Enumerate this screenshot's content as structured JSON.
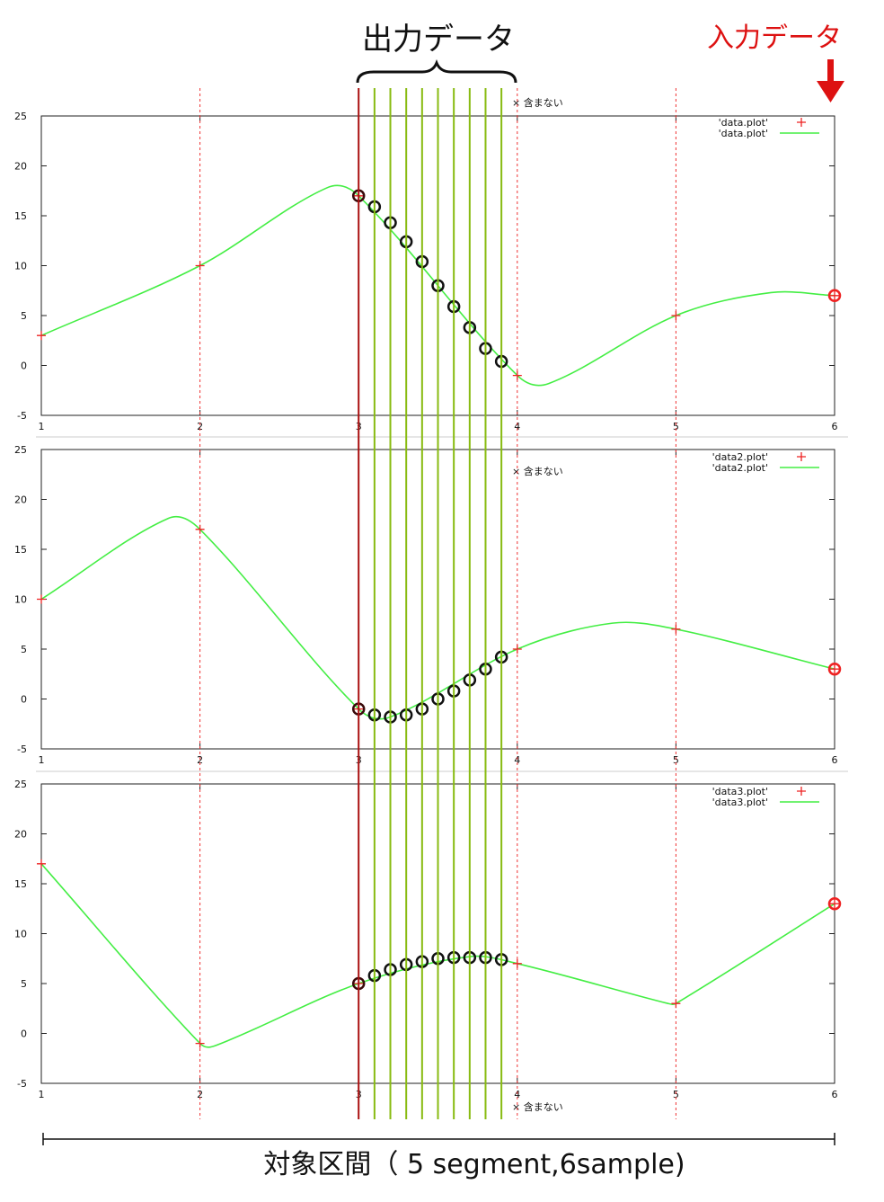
{
  "header": {
    "output_label": "出力データ",
    "input_label": "入力データ",
    "input_color": "#dd1111"
  },
  "footer": {
    "range_label": "対象区間（ 5 segment,6sample)"
  },
  "colors": {
    "curve": "#44ee44",
    "sample_marker": "#ee2222",
    "grid_dash": "#ee3333",
    "segment_start_line": "#aa1111",
    "output_line": "#88bb11",
    "output_circle": "#111111"
  },
  "icons": [
    "brace-icon",
    "down-arrow-icon",
    "cross-mark-icon"
  ],
  "chart_data": [
    {
      "type": "line",
      "xlim": [
        1,
        6
      ],
      "ylim": [
        -5,
        25
      ],
      "x_ticks": [
        "1",
        "2",
        "3",
        "4",
        "5",
        "6"
      ],
      "y_ticks": [
        "25",
        "20",
        "15",
        "10",
        "5",
        "0",
        "-5"
      ],
      "grid": false,
      "legend_position": "top-right",
      "legend": [
        "'data.plot'",
        "'data.plot'"
      ],
      "note": "× 含まない",
      "samples": {
        "x": [
          1,
          2,
          3,
          4,
          5,
          6
        ],
        "y": [
          3,
          10,
          17,
          -1,
          5,
          7
        ]
      },
      "curve_peaks": [
        {
          "x": 2.8,
          "y": 17.8
        },
        {
          "x": 4.2,
          "y": -1.8
        },
        {
          "x": 5.6,
          "y": 7.3
        }
      ],
      "output": {
        "x": [
          3.0,
          3.1,
          3.2,
          3.3,
          3.4,
          3.5,
          3.6,
          3.7,
          3.8,
          3.9
        ],
        "y": [
          17.0,
          15.9,
          14.3,
          12.4,
          10.4,
          8.0,
          5.9,
          3.8,
          1.7,
          0.4
        ]
      },
      "input_highlight": {
        "x": 6,
        "y": 7
      }
    },
    {
      "type": "line",
      "xlim": [
        1,
        6
      ],
      "ylim": [
        -5,
        25
      ],
      "x_ticks": [
        "1",
        "2",
        "3",
        "4",
        "5",
        "6"
      ],
      "y_ticks": [
        "25",
        "20",
        "15",
        "10",
        "5",
        "0",
        "-5"
      ],
      "grid": false,
      "legend_position": "top-right",
      "legend": [
        "'data2.plot'",
        "'data2.plot'"
      ],
      "note": "× 含まない",
      "samples": {
        "x": [
          1,
          2,
          3,
          4,
          5,
          6
        ],
        "y": [
          10,
          17,
          -1,
          5,
          7,
          3
        ]
      },
      "curve_peaks": [
        {
          "x": 1.8,
          "y": 18.1
        },
        {
          "x": 3.2,
          "y": -1.8
        },
        {
          "x": 4.6,
          "y": 7.6
        }
      ],
      "output": {
        "x": [
          3.0,
          3.1,
          3.2,
          3.3,
          3.4,
          3.5,
          3.6,
          3.7,
          3.8,
          3.9
        ],
        "y": [
          -1.0,
          -1.6,
          -1.8,
          -1.6,
          -1.0,
          0.0,
          0.8,
          1.9,
          3.0,
          4.2
        ]
      },
      "input_highlight": {
        "x": 6,
        "y": 3
      }
    },
    {
      "type": "line",
      "xlim": [
        1,
        6
      ],
      "ylim": [
        -5,
        25
      ],
      "x_ticks": [
        "1",
        "2",
        "3",
        "4",
        "5",
        "6"
      ],
      "y_ticks": [
        "25",
        "20",
        "15",
        "10",
        "5",
        "0",
        "-5"
      ],
      "grid": false,
      "legend_position": "top-right",
      "legend": [
        "'data3.plot'",
        "'data3.plot'"
      ],
      "note": "× 含まない",
      "samples": {
        "x": [
          1,
          2,
          3,
          4,
          5,
          6
        ],
        "y": [
          17,
          -1,
          5,
          7,
          3,
          13
        ]
      },
      "curve_peaks": [
        {
          "x": 2.1,
          "y": -1.2
        },
        {
          "x": 3.7,
          "y": 7.7
        },
        {
          "x": 4.95,
          "y": 3.0
        }
      ],
      "output": {
        "x": [
          3.0,
          3.1,
          3.2,
          3.3,
          3.4,
          3.5,
          3.6,
          3.7,
          3.8,
          3.9
        ],
        "y": [
          5.0,
          5.8,
          6.4,
          6.9,
          7.2,
          7.5,
          7.6,
          7.6,
          7.6,
          7.4
        ]
      },
      "input_highlight": {
        "x": 6,
        "y": 13
      }
    }
  ]
}
